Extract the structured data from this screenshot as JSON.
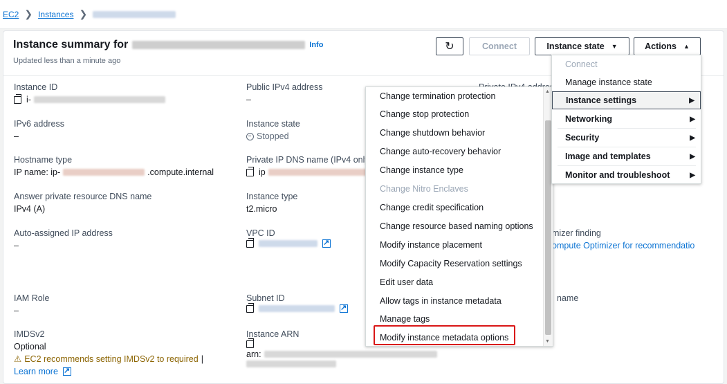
{
  "breadcrumb": {
    "root": "EC2",
    "instances": "Instances"
  },
  "header": {
    "title": "Instance summary for",
    "info": "Info",
    "updated": "Updated less than a minute ago",
    "buttons": {
      "connect": "Connect",
      "instance_state": "Instance state",
      "actions": "Actions"
    }
  },
  "fields": {
    "instance_id": {
      "label": "Instance ID",
      "value_prefix": "i-"
    },
    "public_ipv4": {
      "label": "Public IPv4 address",
      "value": "–"
    },
    "private_ipv4": {
      "label": "Private IPv4 addres"
    },
    "ipv6": {
      "label": "IPv6 address",
      "value": "–"
    },
    "instance_state": {
      "label": "Instance state",
      "value": "Stopped"
    },
    "hostname_type": {
      "label": "Hostname type",
      "value_prefix": "IP name: ip-",
      "value_suffix": ".compute.internal"
    },
    "private_ip_dns": {
      "label": "Private IP DNS name (IPv4 only",
      "value_prefix": "ip"
    },
    "answer_dns": {
      "label": "Answer private resource DNS name",
      "value": "IPv4 (A)"
    },
    "instance_type": {
      "label": "Instance type",
      "value": "t2.micro"
    },
    "auto_ip": {
      "label": "Auto-assigned IP address",
      "value": "–"
    },
    "vpc_id": {
      "label": "VPC ID"
    },
    "optimizer": {
      "label": "mizer finding",
      "link": "ompute Optimizer for recommendatio"
    },
    "iam_role": {
      "label": "IAM Role",
      "value": "–"
    },
    "subnet_id": {
      "label": "Subnet ID"
    },
    "name_partial": {
      "label": "name"
    },
    "imdsv2": {
      "label": "IMDSv2",
      "value": "Optional",
      "warning": "EC2 recommends setting IMDSv2 to required",
      "learn_more": "Learn more"
    },
    "instance_arn": {
      "label": "Instance ARN",
      "value_prefix": "arn:"
    }
  },
  "actions_menu": {
    "items": [
      {
        "label": "Connect",
        "disabled": true
      },
      {
        "label": "Manage instance state"
      },
      {
        "label": "Instance settings",
        "submenu": true,
        "active": true
      },
      {
        "label": "Networking",
        "submenu": true
      },
      {
        "label": "Security",
        "submenu": true
      },
      {
        "label": "Image and templates",
        "submenu": true
      },
      {
        "label": "Monitor and troubleshoot",
        "submenu": true
      }
    ]
  },
  "instance_settings_menu": {
    "items": [
      "Change termination protection",
      "Change stop protection",
      "Change shutdown behavior",
      "Change auto-recovery behavior",
      "Change instance type",
      "Change Nitro Enclaves",
      "Change credit specification",
      "Change resource based naming options",
      "Modify instance placement",
      "Modify Capacity Reservation settings",
      "Edit user data",
      "Allow tags in instance metadata",
      "Manage tags",
      "Modify instance metadata options"
    ],
    "highlighted": "Modify instance metadata options"
  },
  "icons": {
    "refresh": "refresh-icon",
    "copy": "copy-icon",
    "external": "external-link-icon",
    "warning": "warning-icon",
    "caret": "caret-icon",
    "submenu_arrow": "chevron-right-icon"
  },
  "colors": {
    "link": "#0972d3",
    "highlight_border": "#d91515",
    "warning": "#8d6605"
  }
}
